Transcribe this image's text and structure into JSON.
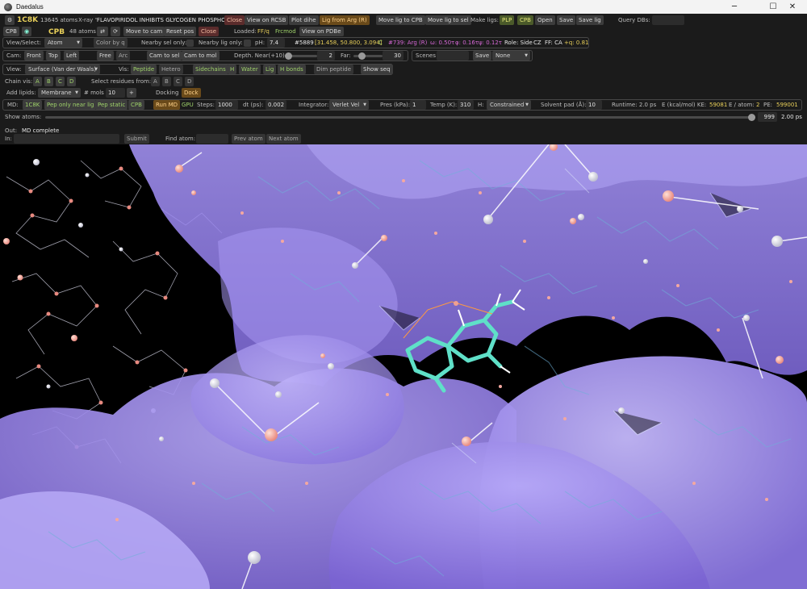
{
  "window": {
    "title": "Daedalus"
  },
  "row1": {
    "pdb_id": "1C8K",
    "atom_count": "13645 atoms",
    "method": "X-ray",
    "description": "'FLAVOPIRIDOL INHIBITS GLYCOGEN PHOSPHOR...",
    "close": "Close",
    "view_rcsb": "View on RCSB",
    "plot_dihe": "Plot dihe",
    "lig_from_arg": "Lig from Arg (R)",
    "move_lig_cpb": "Move lig to CPB",
    "move_lig_sel": "Move lig to sel",
    "make_ligs": "Make ligs:",
    "plp": "PLP",
    "cpb": "CPB",
    "open": "Open",
    "save": "Save",
    "save_lig": "Save lig",
    "query_dbs": "Query DBs:"
  },
  "row2": {
    "cpb_btn": "CPB",
    "lig_name": "CPB",
    "lig_atoms": "48 atoms",
    "move_to_cam": "Move to cam",
    "reset_pos": "Reset pos",
    "close": "Close",
    "loaded": "Loaded:",
    "ff_q": "FF/q",
    "frcmod": "Frcmod",
    "view_pdbe": "View on PDBe"
  },
  "row3": {
    "view_select": "View/Select:",
    "view_select_value": "Atom",
    "color_by_q": "Color by q",
    "nearby_sel_only": "Nearby sel only:",
    "nearby_lig_only": "Nearby lig only:",
    "ph": "pH:",
    "ph_value": "7.4",
    "atom_num": "#5889",
    "atom_pos": "[31.458, 50.800, 3.094]",
    "atom_el": "C",
    "res_info": "#739: Arg (R)",
    "omega": "ω: 0.50τ",
    "phi": "φ: 0.16τ",
    "psi": "ψ: 0.12τ",
    "role": "Role: Side",
    "role_el": "CZ",
    "ff": "FF: CA",
    "q": "+q: 0.81"
  },
  "row4": {
    "cam": "Cam:",
    "front": "Front",
    "top": "Top",
    "left": "Left",
    "free": "Free",
    "arc": "Arc",
    "cam_to_sel": "Cam to sel",
    "cam_to_mol": "Cam to mol",
    "depth_near": "Depth. Near(+10):",
    "near_value": "2",
    "far": "Far:",
    "far_value": "30",
    "scenes": "Scenes",
    "save": "Save",
    "scene_select": "None",
    "near_fraction": 0.0,
    "far_fraction": 0.24
  },
  "row5": {
    "view": "View:",
    "view_mode": "Surface (Van der Waals)",
    "vis": "Vis:",
    "peptide": "Peptide",
    "hetero": "Hetero",
    "sidechains": "Sidechains",
    "h": "H",
    "water": "Water",
    "lig": "Lig",
    "h_bonds": "H bonds",
    "dim_peptide": "Dim peptide",
    "show_seq": "Show seq"
  },
  "row6": {
    "chain_vis": "Chain vis:",
    "chains": [
      "A",
      "B",
      "C",
      "D"
    ],
    "select_residues_from": "Select residues from:",
    "sel_chains": [
      "A",
      "B",
      "C",
      "D"
    ]
  },
  "row7": {
    "add_lipids": "Add lipids:",
    "lipid_type": "Membrane",
    "n_mols": "# mols",
    "n_mols_value": "10",
    "plus": "+",
    "docking": "Docking",
    "dock": "Dock"
  },
  "row8": {
    "md": "MD:",
    "md_pdb": "1C8K",
    "pep_only_near_lig": "Pep only near lig",
    "pep_static": "Pep static",
    "cpb": "CPB",
    "run_md": "Run MD",
    "gpu": "GPU",
    "steps": "Steps:",
    "steps_value": "1000",
    "dt": "dt (ps):",
    "dt_value": "0.002",
    "integrator": "Integrator:",
    "integrator_value": "Verlet Vel",
    "pres": "Pres (kPa):",
    "pres_value": "1",
    "temp": "Temp (K):",
    "temp_value": "310",
    "h": "H:",
    "h_value": "Constrained",
    "solvent_pad": "Solvent pad (Å):",
    "solvent_pad_value": "10",
    "runtime": "Runtime: 2.0 ps",
    "energy": "E (kcal/mol) KE:",
    "ke_value": "59081",
    "e_per_atom": "E / atom:",
    "e_per_atom_value": "2",
    "pe": "PE:",
    "pe_value": "599001"
  },
  "row9": {
    "show_atoms": "Show atoms:",
    "frame_value": "999",
    "time_value": "2.00 ps",
    "slider_fraction": 1.0
  },
  "row10": {
    "out": "Out:",
    "out_value": "MD complete"
  },
  "row11": {
    "in": "In:",
    "submit": "Submit",
    "find_atom": "Find atom:",
    "prev_atom": "Prev atom",
    "next_atom": "Next atom"
  },
  "colors": {
    "surface": "#9b87f0",
    "ligand": "#5fe0c8",
    "pdb": "#e9d05a",
    "background": "#000000"
  }
}
